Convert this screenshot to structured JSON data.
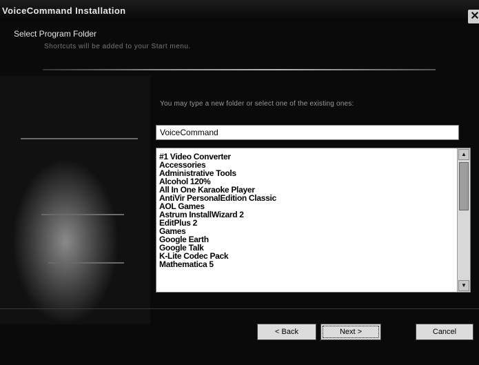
{
  "window": {
    "title": "VoiceCommand Installation",
    "close_label": "✕"
  },
  "header": {
    "subtitle": "Select Program Folder",
    "description": "Shortcuts will be added to your Start menu."
  },
  "instruction": "You may type a new folder or select one of the existing ones:",
  "folder_input": {
    "value": "VoiceCommand"
  },
  "folder_list": {
    "items": [
      "#1 Video Converter",
      "Accessories",
      "Administrative Tools",
      "Alcohol 120%",
      "All In One Karaoke Player",
      "AntiVir PersonalEdition Classic",
      "AOL Games",
      "Astrum InstallWizard 2",
      "EditPlus 2",
      "Games",
      "Google Earth",
      "Google Talk",
      "K-Lite Codec Pack",
      "Mathematica 5"
    ]
  },
  "scrollbar": {
    "up_icon": "▲",
    "down_icon": "▼"
  },
  "buttons": {
    "back": "< Back",
    "next": "Next >",
    "cancel": "Cancel"
  }
}
